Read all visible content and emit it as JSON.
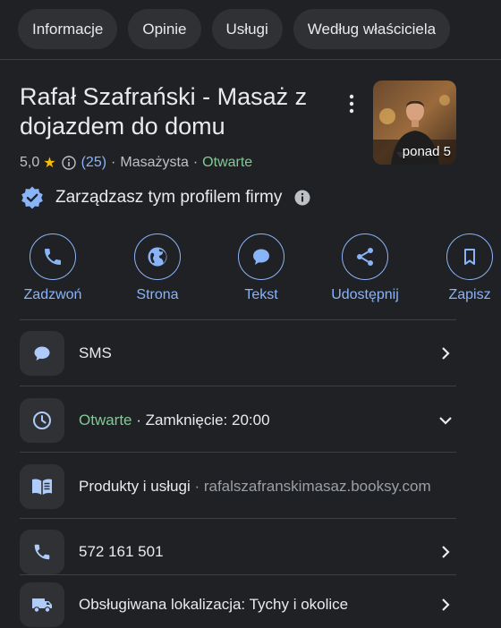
{
  "tabs": [
    "Informacje",
    "Opinie",
    "Usługi",
    "Według właściciela"
  ],
  "business": {
    "name": "Rafał Szafrański - Masaż z dojazdem do domu",
    "rating": "5,0",
    "reviews": "(25)",
    "dot": "·",
    "category": "Masażysta",
    "status": "Otwarte",
    "photo_label": "ponad 5"
  },
  "manage": {
    "text": "Zarządzasz tym profilem firmy"
  },
  "actions": [
    "Zadzwoń",
    "Strona",
    "Tekst",
    "Udostępnij",
    "Zapisz"
  ],
  "rows": {
    "sms": "SMS",
    "hours_status": "Otwarte",
    "hours_rest": " · Zamknięcie: 20:00",
    "products_label": "Produkty i usługi",
    "products_sep": " · ",
    "products_link": "rafalszafranskimasaz.booksy.com",
    "phone": "572 161 501",
    "location": "Obsługiwana lokalizacja: Tychy i okolice"
  },
  "colors": {
    "accent": "#8ab4f8",
    "open": "#81c995",
    "star": "#fbbc04",
    "background": "#202124"
  }
}
